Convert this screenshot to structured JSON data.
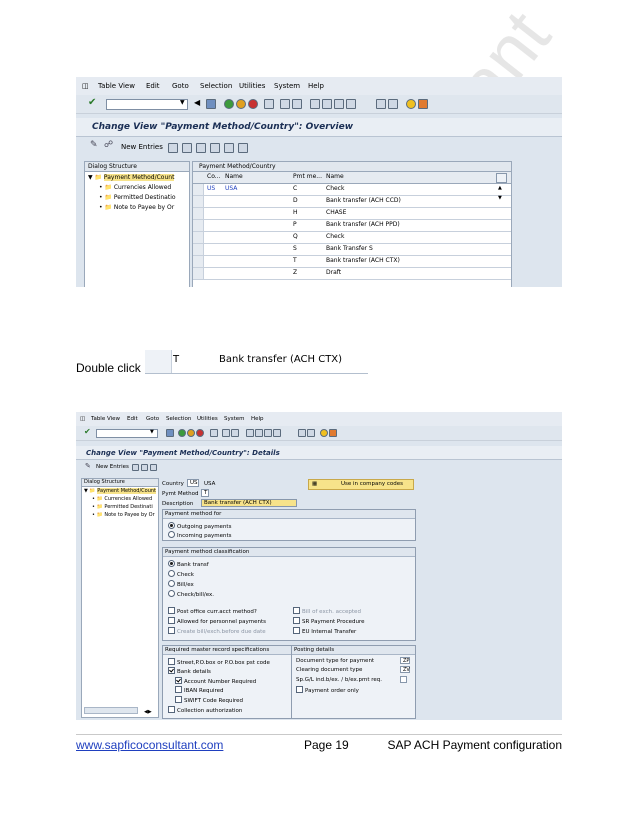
{
  "menu": [
    "Table View",
    "Edit",
    "Goto",
    "Selection",
    "Utilities",
    "System",
    "Help"
  ],
  "shot1": {
    "title": "Change View \"Payment Method/Country\": Overview",
    "new_entries": "New Entries",
    "dialog_structure_label": "Dialog Structure",
    "tree": [
      "Payment Method/Count",
      "Currencies Allowed",
      "Permitted Destinatio",
      "Note to Payee by Or"
    ],
    "table_title": "Payment Method/Country",
    "columns": [
      "Co...",
      "Name",
      "Pmt me...",
      "Name"
    ],
    "rows": [
      {
        "country": "US",
        "cname": "USA",
        "code": "C",
        "name": "Check"
      },
      {
        "country": "",
        "cname": "",
        "code": "D",
        "name": "Bank transfer (ACH CCD)"
      },
      {
        "country": "",
        "cname": "",
        "code": "H",
        "name": "CHASE"
      },
      {
        "country": "",
        "cname": "",
        "code": "P",
        "name": "Bank transfer (ACH PPD)"
      },
      {
        "country": "",
        "cname": "",
        "code": "Q",
        "name": "Check"
      },
      {
        "country": "",
        "cname": "",
        "code": "S",
        "name": "Bank Transfer S"
      },
      {
        "country": "",
        "cname": "",
        "code": "T",
        "name": "Bank transfer (ACH CTX)"
      },
      {
        "country": "",
        "cname": "",
        "code": "Z",
        "name": "Draft"
      }
    ]
  },
  "double_click": {
    "label": "Double click",
    "code": "T",
    "name": "Bank transfer (ACH CTX)"
  },
  "shot2": {
    "title": "Change View \"Payment Method/Country\": Details",
    "new_entries": "New Entries",
    "dialog_structure_label": "Dialog Structure",
    "tree": [
      "Payment Method/Count",
      "Currencies Allowed",
      "Permitted Destinati",
      "Note to Payee by Or"
    ],
    "country_label": "Country",
    "country_code": "US",
    "country_name": "USA",
    "pymt_label": "Pymt Method",
    "pymt_value": "T",
    "desc_label": "Description",
    "desc_value": "Bank transfer (ACH CTX)",
    "use_company_codes": "Use in company codes",
    "pm_for_title": "Payment method for",
    "pm_for": [
      {
        "label": "Outgoing payments",
        "on": true
      },
      {
        "label": "Incoming payments",
        "on": false
      }
    ],
    "classif_title": "Payment method classification",
    "classif": [
      {
        "label": "Bank transf",
        "on": true
      },
      {
        "label": "Check",
        "on": false
      },
      {
        "label": "Bill/ex",
        "on": false
      },
      {
        "label": "Check/bill/ex.",
        "on": false
      }
    ],
    "opts_left": [
      {
        "label": "Post office curr.acct method?",
        "on": false,
        "dis": false
      },
      {
        "label": "Allowed for personnel payments",
        "on": false,
        "dis": false
      },
      {
        "label": "Create bill/exch.before due date",
        "on": false,
        "dis": true
      }
    ],
    "opts_right": [
      {
        "label": "Bill of exch. accepted",
        "on": false,
        "dis": true
      },
      {
        "label": "SR Payment Procedure",
        "on": false,
        "dis": false
      },
      {
        "label": "EU Internal Transfer",
        "on": false,
        "dis": false
      }
    ],
    "req_title": "Required master record specifications",
    "req": [
      {
        "label": "Street,P.O.box or P.O.box pst code",
        "on": false
      },
      {
        "label": "Bank details",
        "on": true
      },
      {
        "label": "Account Number Required",
        "on": true
      },
      {
        "label": "IBAN Required",
        "on": false
      },
      {
        "label": "SWIFT Code Required",
        "on": false
      },
      {
        "label": "Collection authorization",
        "on": false
      }
    ],
    "post_title": "Posting details",
    "post": [
      {
        "label": "Document type for payment",
        "val": "ZP"
      },
      {
        "label": "Clearing document type",
        "val": "ZV"
      },
      {
        "label": "Sp.G/L ind.b/ex. / b/ex.pmt req.",
        "val": ""
      }
    ],
    "payment_order_only": "Payment order only"
  },
  "footer": {
    "website": "www.sapficoconsultant.com",
    "page": "Page 19",
    "doc_title": "SAP ACH Payment configuration"
  },
  "colors": {
    "link": "#1f3fbf",
    "title": "#1b2f55",
    "highlight": "#f7e38a"
  },
  "watermark": "consultant"
}
